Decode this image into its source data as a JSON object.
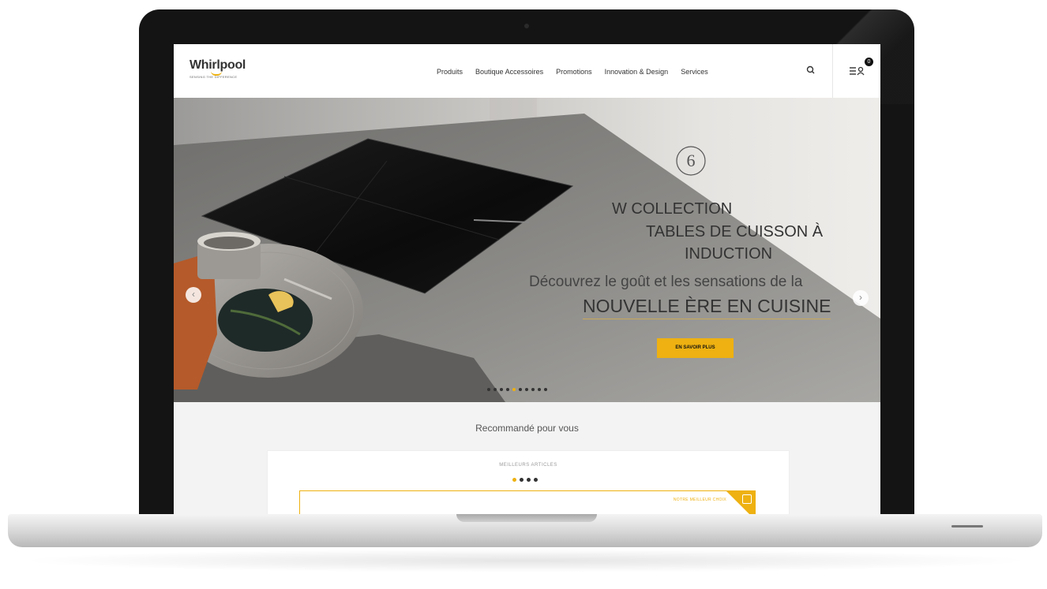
{
  "header": {
    "logo": {
      "name": "Whirlpool",
      "tagline": "SENSING THE DIFFERENCE"
    },
    "nav": [
      "Produits",
      "Boutique Accessoires",
      "Promotions",
      "Innovation & Design",
      "Services"
    ],
    "search_icon": "search-icon",
    "account_icon": "menu-user-icon",
    "cart_count": "0"
  },
  "hero": {
    "badge_icon": "sixth-sense-logo",
    "line1": "W COLLECTION",
    "line2": "TABLES DE CUISSON À",
    "line3": "INDUCTION",
    "line4": "Découvrez le goût et les sensations de la",
    "line5": "NOUVELLE ÈRE EN CUISINE",
    "cta": "EN SAVOIR PLUS",
    "prev_label": "‹",
    "next_label": "›",
    "dots_total": 10,
    "dot_active_index": 4
  },
  "recommend": {
    "title": "Recommandé pour vous",
    "label": "MEILLEURS ARTICLES",
    "dots_total": 4,
    "dot_active_index": 0,
    "inner_label": "NOTRE MEILLEUR CHOIX"
  },
  "colors": {
    "accent": "#eeb111",
    "text": "#333333",
    "page": "#f2f3f2"
  }
}
